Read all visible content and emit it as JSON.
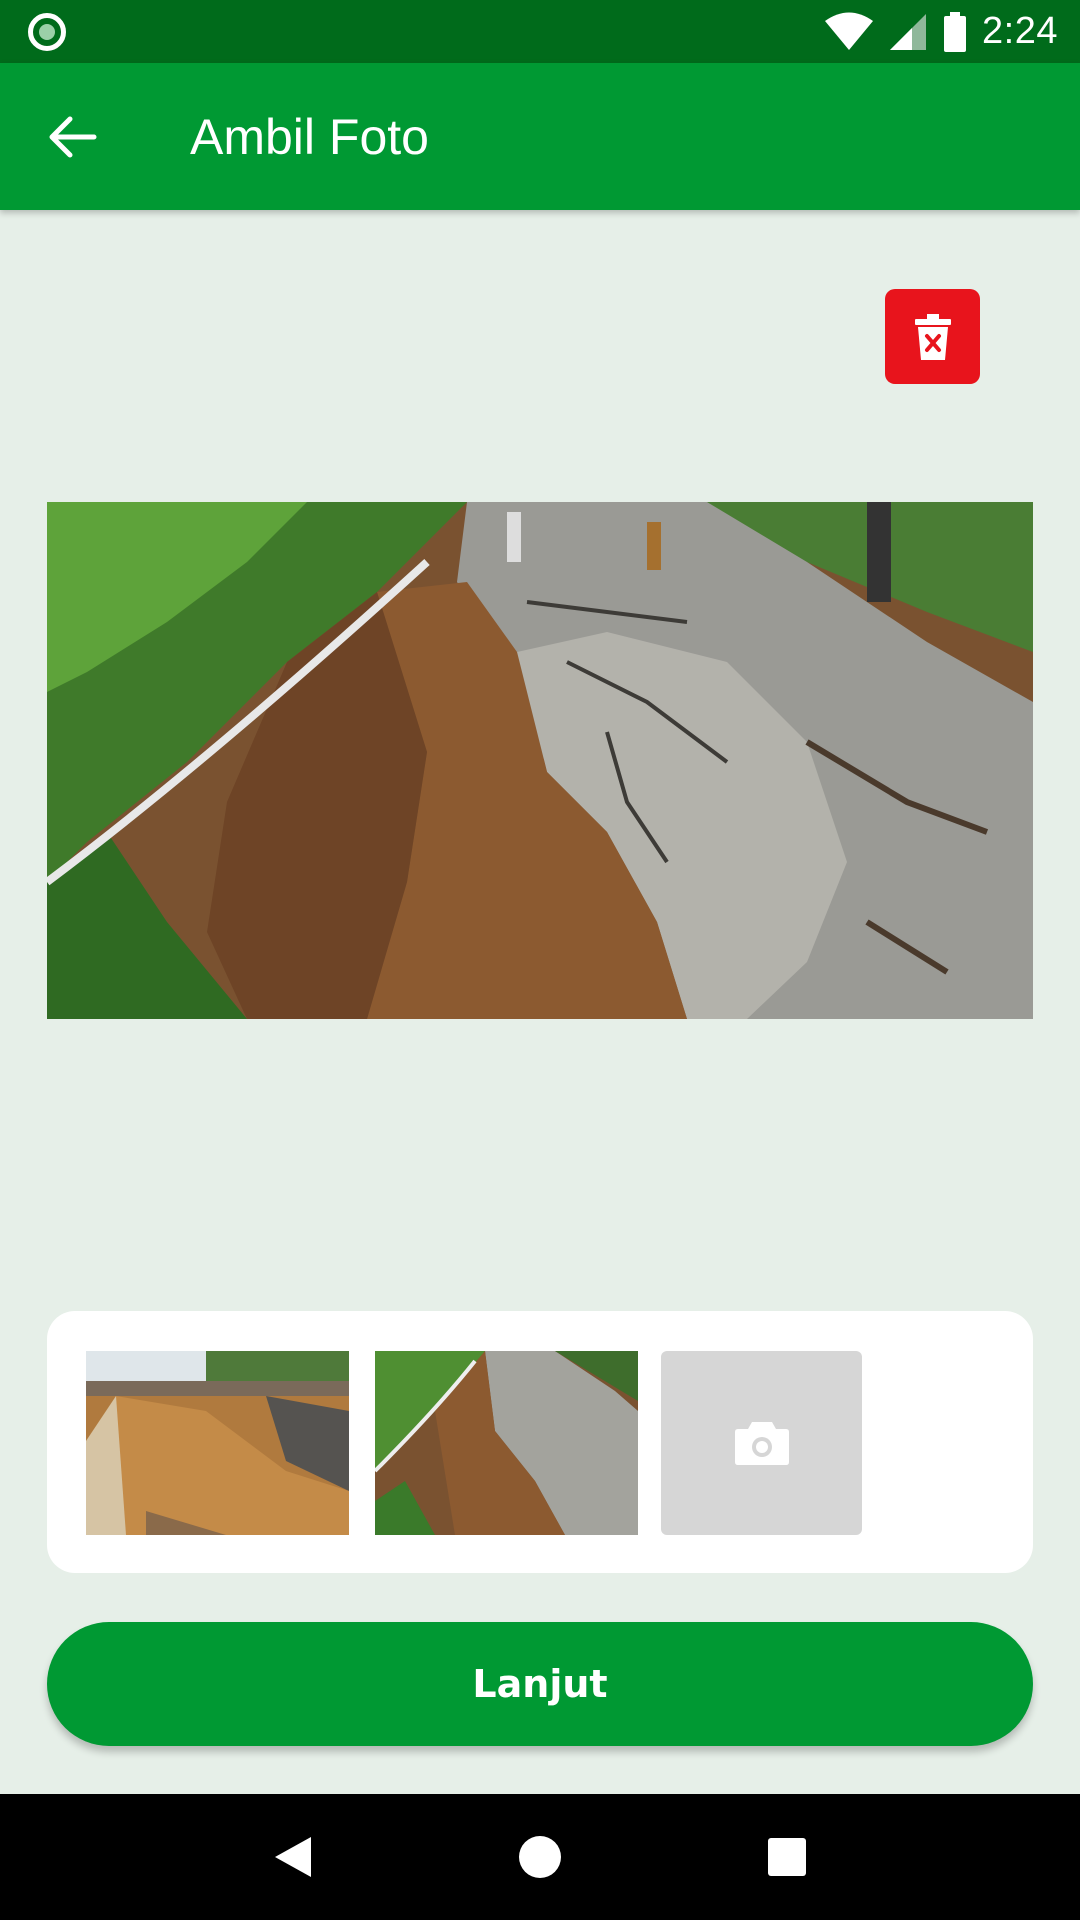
{
  "status_bar": {
    "time": "2:24",
    "icons": [
      "notification-dot-icon",
      "wifi-icon",
      "signal-icon",
      "battery-icon"
    ]
  },
  "app_bar": {
    "title": "Ambil Foto",
    "back_icon": "arrow-left-icon"
  },
  "photo_actions": {
    "delete_icon": "trash-x-icon",
    "delete_color": "#e8141c"
  },
  "thumbnails": [
    {
      "name": "landslide-photo-1"
    },
    {
      "name": "landslide-photo-2",
      "selected": true
    },
    {
      "name": "add-photo",
      "icon": "camera-icon"
    }
  ],
  "footer": {
    "next_label": "Lanjut"
  },
  "nav_bar": {
    "icons": [
      "back-triangle-icon",
      "home-circle-icon",
      "recents-square-icon"
    ]
  },
  "colors": {
    "primary": "#009933",
    "status_bar": "#006b1b",
    "background": "#e6efe8",
    "danger": "#e8141c"
  }
}
